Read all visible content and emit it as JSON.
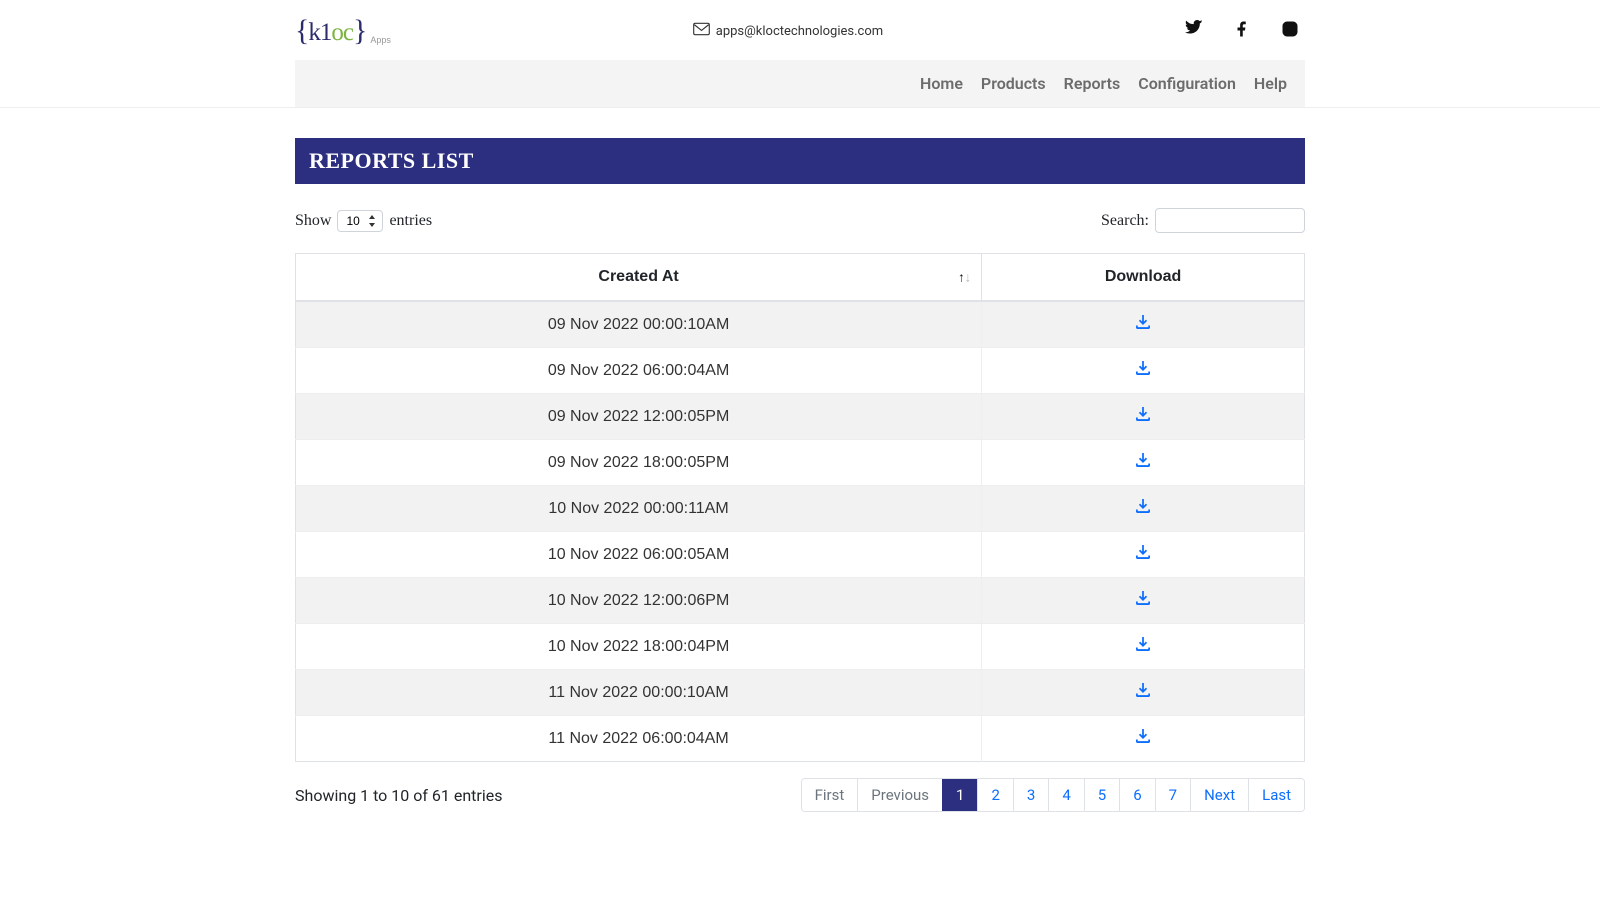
{
  "header": {
    "logo": {
      "part1": "k1",
      "part2": "oc",
      "sub": "Apps"
    },
    "email": "apps@kloctechnologies.com"
  },
  "nav": {
    "items": [
      "Home",
      "Products",
      "Reports",
      "Configuration",
      "Help"
    ]
  },
  "page": {
    "title": "REPORTS LIST"
  },
  "length": {
    "show_label": "Show",
    "entries_label": "entries",
    "value": "10"
  },
  "search": {
    "label": "Search:",
    "value": ""
  },
  "table": {
    "headers": {
      "created_at": "Created At",
      "download": "Download"
    },
    "rows": [
      {
        "created_at": "09 Nov 2022 00:00:10AM"
      },
      {
        "created_at": "09 Nov 2022 06:00:04AM"
      },
      {
        "created_at": "09 Nov 2022 12:00:05PM"
      },
      {
        "created_at": "09 Nov 2022 18:00:05PM"
      },
      {
        "created_at": "10 Nov 2022 00:00:11AM"
      },
      {
        "created_at": "10 Nov 2022 06:00:05AM"
      },
      {
        "created_at": "10 Nov 2022 12:00:06PM"
      },
      {
        "created_at": "10 Nov 2022 18:00:04PM"
      },
      {
        "created_at": "11 Nov 2022 00:00:10AM"
      },
      {
        "created_at": "11 Nov 2022 06:00:04AM"
      }
    ]
  },
  "footer": {
    "info": "Showing 1 to 10 of 61 entries",
    "pagination": {
      "first": "First",
      "previous": "Previous",
      "pages": [
        "1",
        "2",
        "3",
        "4",
        "5",
        "6",
        "7"
      ],
      "next": "Next",
      "last": "Last",
      "active_index": 0
    }
  }
}
